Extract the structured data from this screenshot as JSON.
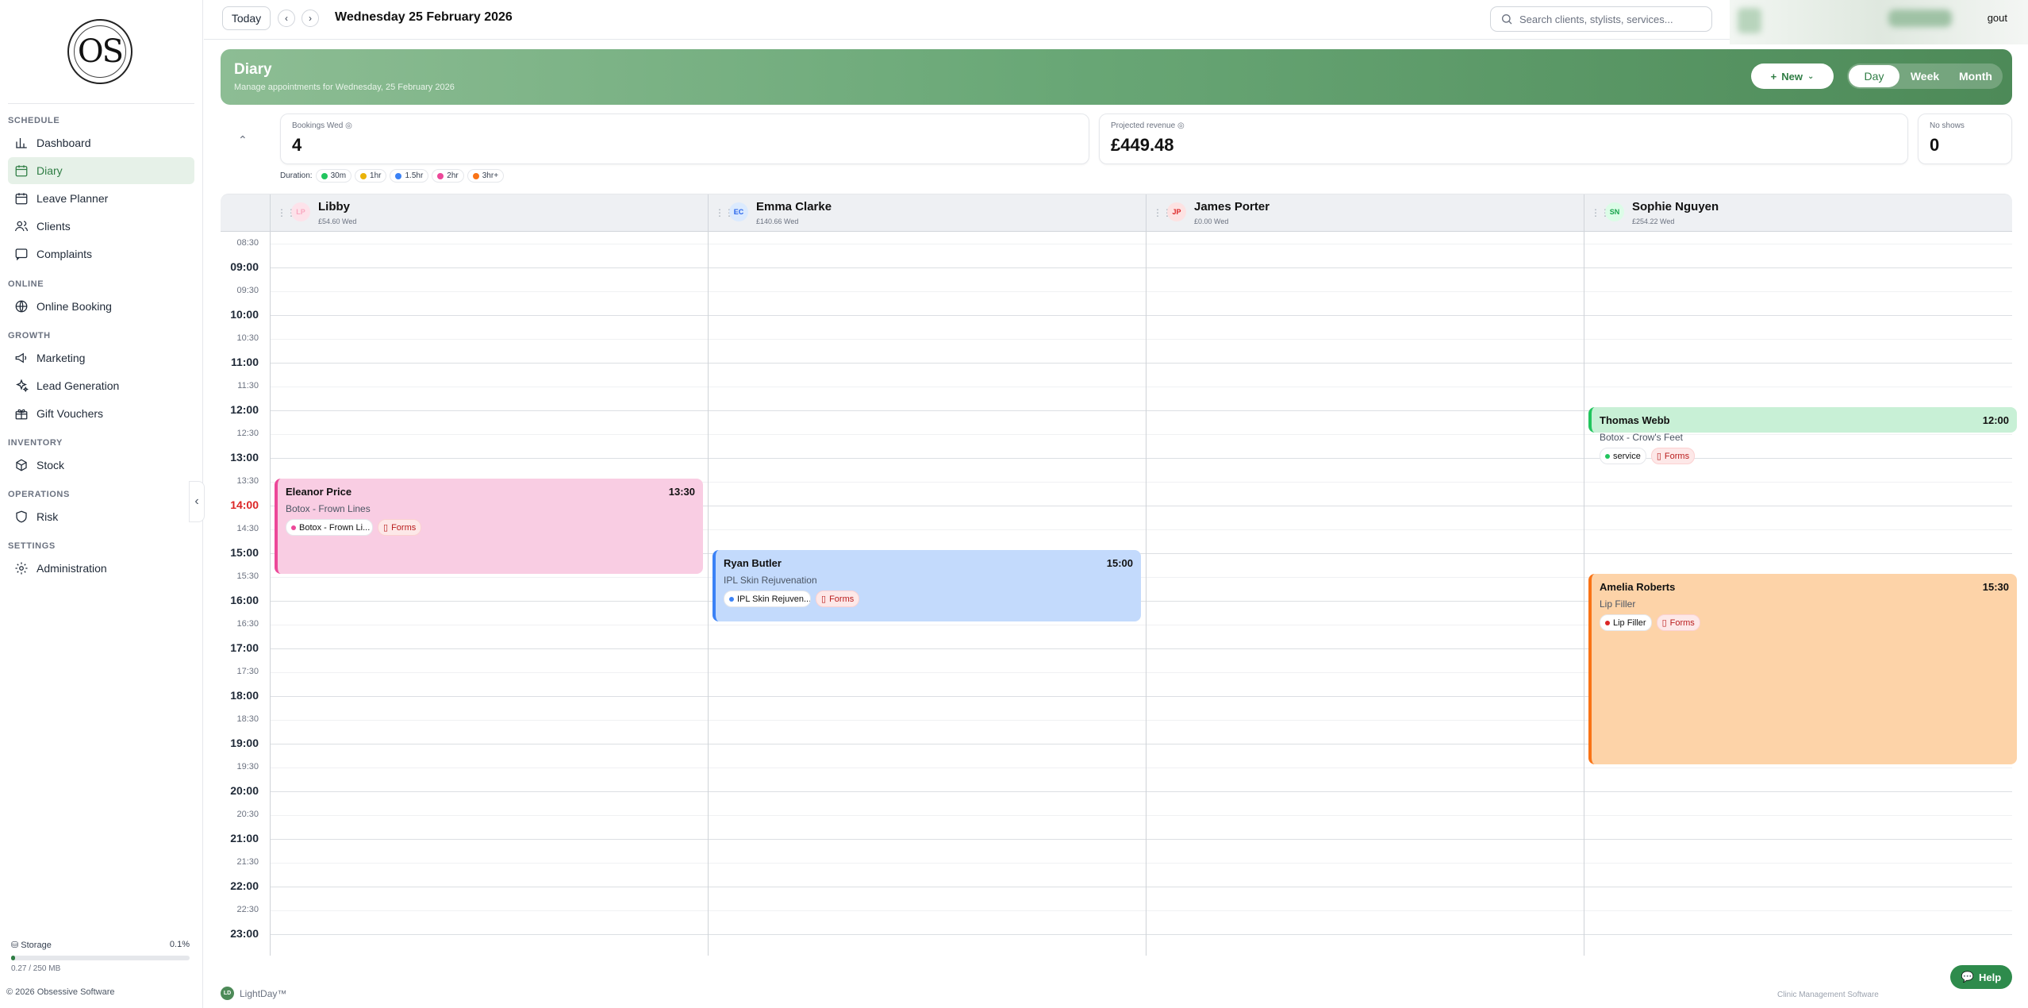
{
  "brand": {
    "logo_text": "OS",
    "logo_ring_text": "OBSESSIVE"
  },
  "sidebar": {
    "sections": [
      {
        "label": "SCHEDULE"
      },
      {
        "label": "ONLINE"
      },
      {
        "label": "GROWTH"
      },
      {
        "label": "INVENTORY"
      },
      {
        "label": "OPERATIONS"
      },
      {
        "label": "SETTINGS"
      }
    ],
    "items": [
      {
        "label": "Dashboard",
        "icon": "chart-icon"
      },
      {
        "label": "Diary",
        "icon": "calendar-icon",
        "active": true
      },
      {
        "label": "Leave Planner",
        "icon": "calendar-icon"
      },
      {
        "label": "Clients",
        "icon": "users-icon"
      },
      {
        "label": "Complaints",
        "icon": "message-icon"
      },
      {
        "label": "Online Booking",
        "icon": "globe-icon"
      },
      {
        "label": "Marketing",
        "icon": "megaphone-icon"
      },
      {
        "label": "Lead Generation",
        "icon": "sparkles-icon"
      },
      {
        "label": "Gift Vouchers",
        "icon": "gift-icon"
      },
      {
        "label": "Stock",
        "icon": "box-icon"
      },
      {
        "label": "Risk",
        "icon": "shield-icon"
      },
      {
        "label": "Administration",
        "icon": "gear-icon"
      }
    ],
    "storage": {
      "label": "Storage",
      "percent": "0.1%",
      "usage": "0.27 / 250 MB",
      "fraction": 0.001
    },
    "copyright": "© 2026 Obsessive Software"
  },
  "topbar": {
    "today_label": "Today",
    "prev_icon": "chevron-left-icon",
    "next_icon": "chevron-right-icon",
    "date_title": "Wednesday 25 February 2026",
    "search_placeholder": "Search clients, stylists, services...",
    "logout_label": "gout"
  },
  "diary": {
    "title": "Diary",
    "subtitle": "Manage appointments for Wednesday, 25 February 2026",
    "new_label": "New",
    "views": [
      "Day",
      "Week",
      "Month"
    ],
    "active_view": "Day"
  },
  "stats": {
    "bookings": {
      "label": "Bookings Wed",
      "value": "4"
    },
    "revenue": {
      "label": "Projected revenue",
      "value": "£449.48"
    },
    "no_shows": {
      "label": "No shows",
      "value": "0"
    }
  },
  "duration_legend": {
    "label": "Duration:",
    "items": [
      {
        "label": "30m",
        "color": "#22c55e"
      },
      {
        "label": "1hr",
        "color": "#eab308"
      },
      {
        "label": "1.5hr",
        "color": "#3b82f6"
      },
      {
        "label": "2hr",
        "color": "#ec4899"
      },
      {
        "label": "3hr+",
        "color": "#f97316"
      }
    ]
  },
  "staff": [
    {
      "name": "Libby",
      "initials": "LP",
      "revenue": "£54.60 Wed",
      "avatar_bg": "#fde2ea",
      "avatar_fg": "#f9a8c0"
    },
    {
      "name": "Emma Clarke",
      "initials": "EC",
      "revenue": "£140.66 Wed",
      "avatar_bg": "#dbeafe",
      "avatar_fg": "#2563eb"
    },
    {
      "name": "James Porter",
      "initials": "JP",
      "revenue": "£0.00 Wed",
      "avatar_bg": "#fde2e2",
      "avatar_fg": "#dc2626"
    },
    {
      "name": "Sophie Nguyen",
      "initials": "SN",
      "revenue": "£254.22 Wed",
      "avatar_bg": "#dcfce7",
      "avatar_fg": "#16a34a"
    }
  ],
  "timeline": {
    "labels": [
      "08:30",
      "09:00",
      "09:30",
      "10:00",
      "10:30",
      "11:00",
      "11:30",
      "12:00",
      "12:30",
      "13:00",
      "13:30",
      "14:00",
      "14:30",
      "15:00",
      "15:30",
      "16:00",
      "16:30",
      "17:00",
      "17:30",
      "18:00",
      "18:30",
      "19:00",
      "19:30",
      "20:00",
      "20:30",
      "21:00",
      "21:30",
      "22:00",
      "22:30",
      "23:00"
    ],
    "current_hour": "14:00"
  },
  "appointments": [
    {
      "staff": 0,
      "client": "Eleanor Price",
      "time": "13:30",
      "service": "Botox - Frown Lines",
      "tag": "Botox - Frown Li...",
      "tag_color": "#ec4899",
      "forms": "Forms",
      "start": "13:30",
      "end": "15:30",
      "bg": "#f9cde3",
      "border": "#ec4899"
    },
    {
      "staff": 1,
      "client": "Ryan Butler",
      "time": "15:00",
      "service": "IPL Skin Rejuvenation",
      "tag": "IPL Skin Rejuven...",
      "tag_color": "#3b82f6",
      "forms": "Forms",
      "start": "15:00",
      "end": "16:30",
      "bg": "#c3dafc",
      "border": "#3b82f6"
    },
    {
      "staff": 3,
      "client": "Thomas Webb",
      "time": "12:00",
      "service": "Botox - Crow's Feet",
      "tag": "service",
      "tag_color": "#22c55e",
      "forms": "Forms",
      "start": "12:00",
      "end": "12:30",
      "bg": "#c8f0d6",
      "border": "#22c55e"
    },
    {
      "staff": 3,
      "client": "Amelia Roberts",
      "time": "15:30",
      "service": "Lip Filler",
      "tag": "Lip Filler",
      "tag_color": "#dc2626",
      "forms": "Forms",
      "start": "15:30",
      "end": "19:30",
      "bg": "#fdd3a8",
      "border": "#f97316"
    }
  ],
  "footer": {
    "brand": "LightDay™",
    "brand_badge": "LD",
    "right_text": "Clinic Management Software"
  },
  "help": {
    "label": "Help"
  }
}
